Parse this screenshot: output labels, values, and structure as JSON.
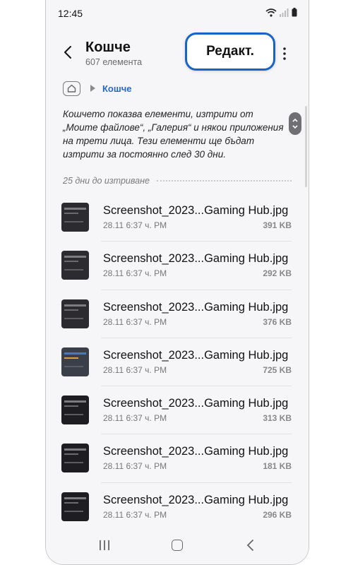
{
  "statusbar": {
    "time": "12:45"
  },
  "header": {
    "title": "Кошче",
    "subtitle": "607 елемента",
    "edit_label": "Редакт."
  },
  "breadcrumb": {
    "current": "Кошче"
  },
  "info_text": "Кошчето показва елементи, изтрити от „Моите файлове“, „Галерия“ и някои приложения на трети лица. Тези елементи ще бъдат изтрити за постоянно след 30 дни.",
  "section": {
    "label": "25 дни до изтриване"
  },
  "files": [
    {
      "name": "Screenshot_2023...Gaming Hub.jpg",
      "date": "28.11 6:37 ч. PM",
      "size": "391 KB"
    },
    {
      "name": "Screenshot_2023...Gaming Hub.jpg",
      "date": "28.11 6:37 ч. PM",
      "size": "292 KB"
    },
    {
      "name": "Screenshot_2023...Gaming Hub.jpg",
      "date": "28.11 6:37 ч. PM",
      "size": "376 KB"
    },
    {
      "name": "Screenshot_2023...Gaming Hub.jpg",
      "date": "28.11 6:37 ч. PM",
      "size": "725 KB"
    },
    {
      "name": "Screenshot_2023...Gaming Hub.jpg",
      "date": "28.11 6:37 ч. PM",
      "size": "313 KB"
    },
    {
      "name": "Screenshot_2023...Gaming Hub.jpg",
      "date": "28.11 6:37 ч. PM",
      "size": "181 KB"
    },
    {
      "name": "Screenshot_2023...Gaming Hub.jpg",
      "date": "28.11 6:37 ч. PM",
      "size": "296 KB"
    }
  ],
  "icons": {
    "back": "back-arrow-icon",
    "more": "more-vertical-icon",
    "home": "home-icon",
    "wifi": "wifi-icon",
    "signal": "signal-icon",
    "battery": "battery-icon",
    "nav_recents": "recents-icon",
    "nav_home": "home-button-icon",
    "nav_back": "back-nav-icon"
  },
  "colors": {
    "accent": "#2766c9",
    "highlight": "#1764c8"
  }
}
